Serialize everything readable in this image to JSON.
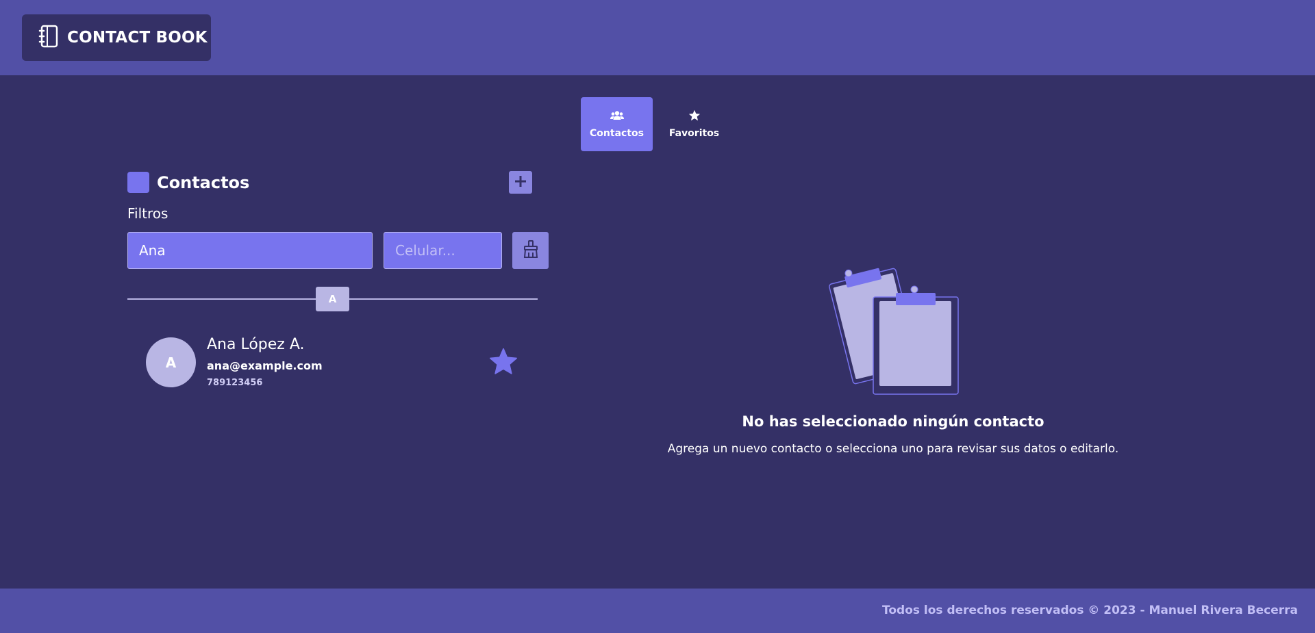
{
  "header": {
    "brand_icon": "notebook-icon",
    "brand_title": "CONTACT BOOK"
  },
  "tabs": [
    {
      "label": "Contactos",
      "icon": "users-icon",
      "active": true
    },
    {
      "label": "Favoritos",
      "icon": "star-icon",
      "active": false
    }
  ],
  "contacts_panel": {
    "title": "Contactos",
    "add_icon": "plus-icon",
    "filters_label": "Filtros",
    "name_filter": {
      "value": "Ana",
      "placeholder": ""
    },
    "phone_filter": {
      "value": "",
      "placeholder": "Celular..."
    },
    "clear_icon": "broom-icon",
    "group_letter": "A",
    "contacts": [
      {
        "initial": "A",
        "name": "Ana López A.",
        "email": "ana@example.com",
        "phone": "789123456",
        "favorite": true
      }
    ]
  },
  "detail": {
    "illustration_icon": "clipboards-icon",
    "empty_title": "No has seleccionado ningún contacto",
    "empty_subtitle": "Agrega un nuevo contacto o selecciona uno para revisar sus datos o editarlo."
  },
  "footer": {
    "text": "Todos los derechos reservados © 2023 - Manuel Rivera Becerra"
  },
  "colors": {
    "header_bg": "#5250a6",
    "body_bg": "#343066",
    "accent": "#7874ee",
    "muted": "#b9b6e4"
  }
}
